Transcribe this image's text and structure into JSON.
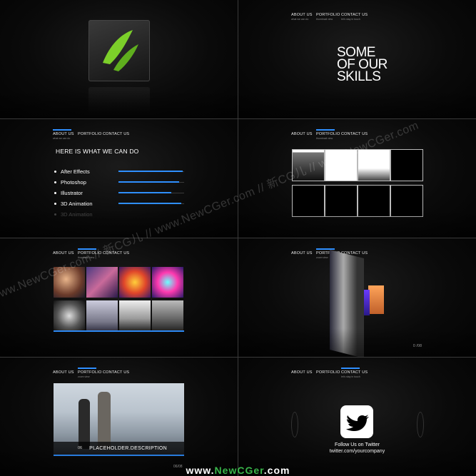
{
  "nav": {
    "about": "ABOUT US",
    "about_sub": "what we can do",
    "portfolio": "PORTFOLIO",
    "portfolio_sub": "thumbnail view",
    "portfolio_zoom_sub": "zoom view",
    "contact": "CONTACT US",
    "contact_sub": "let's stay in touch"
  },
  "skills_title": [
    "SOME",
    "OF OUR",
    "SKILLS"
  ],
  "services": {
    "heading": "HERE IS WHAT WE CAN DO",
    "items": [
      {
        "label": "After Effects",
        "level": 0.98
      },
      {
        "label": "Photoshop",
        "level": 0.92
      },
      {
        "label": "Illustrator",
        "level": 0.8
      },
      {
        "label": "3D Animation",
        "level": 0.96
      },
      {
        "label": "3D Animation",
        "level": 0.5
      }
    ]
  },
  "zoom_view": {
    "counter": "0 /08"
  },
  "portfolio_item": {
    "number": "06",
    "caption": "PLACEHOLDER.DESCRIPTION",
    "pager": "06/08"
  },
  "contact": {
    "follow": "Follow Us on Twitter",
    "url": "twitter.com/yourcompany"
  },
  "watermark": "www.NewCGer.com // 新CG儿 // www.NewCGer.com // 新CG儿 // www.NewCGer.com",
  "footer": {
    "prefix": "www.",
    "highlight": "NewCGer",
    "suffix": ".com"
  },
  "colors": {
    "accent": "#2f8fff",
    "logo_green": "#7ccf2a",
    "footer_green": "#39b54a"
  }
}
